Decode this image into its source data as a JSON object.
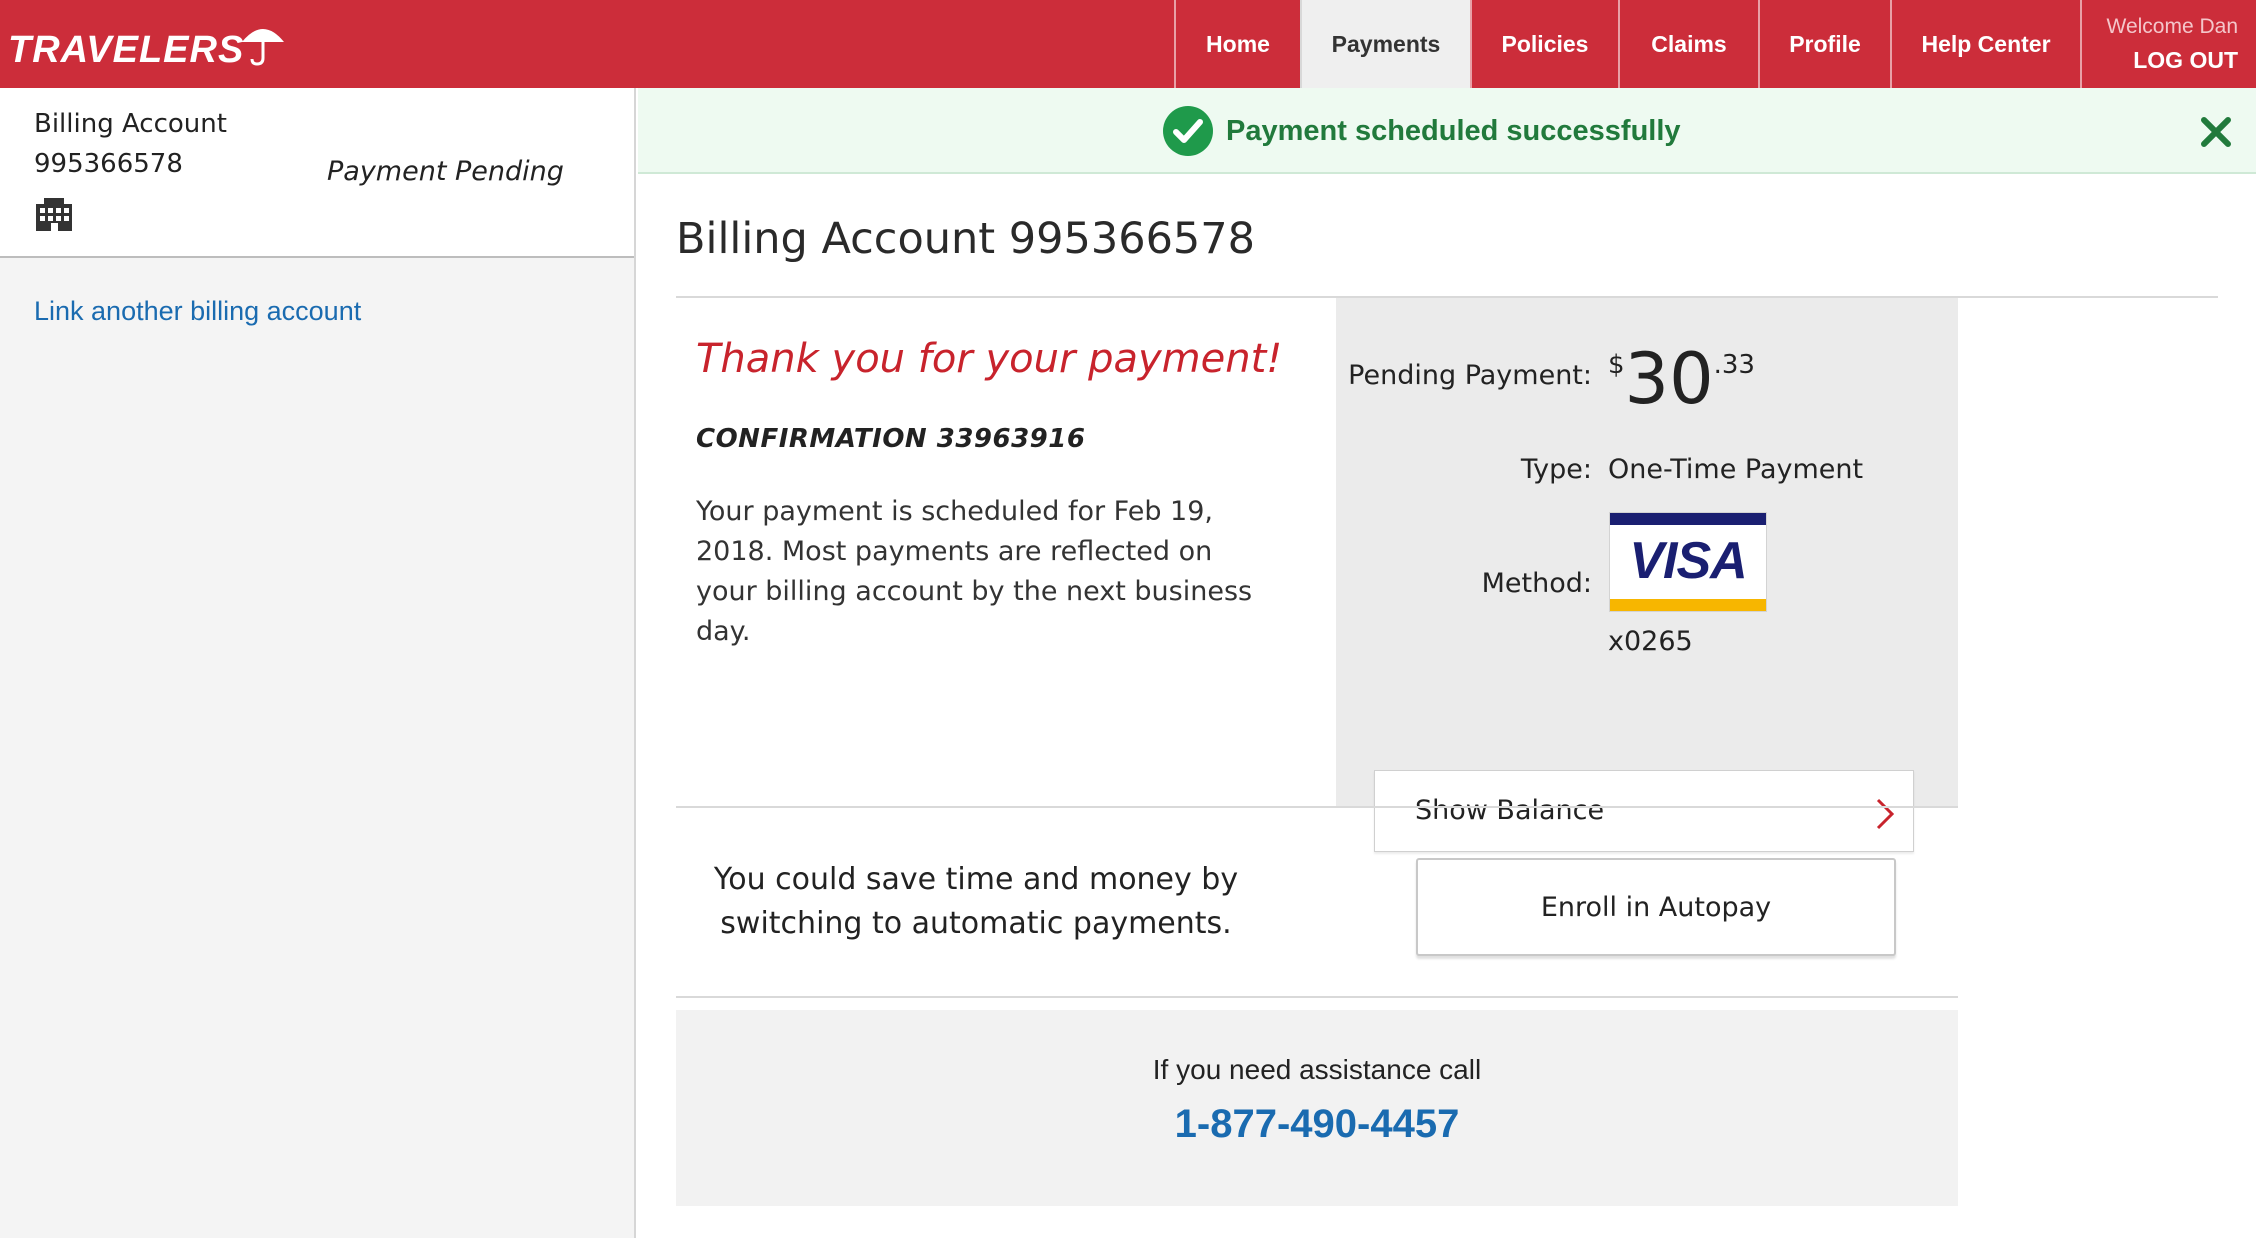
{
  "header": {
    "logo_text": "TRAVELERS",
    "nav": [
      {
        "label": "Home"
      },
      {
        "label": "Payments"
      },
      {
        "label": "Policies"
      },
      {
        "label": "Claims"
      },
      {
        "label": "Profile"
      },
      {
        "label": "Help Center"
      }
    ],
    "welcome": "Welcome Dan",
    "logout": "LOG OUT",
    "brand_color": "#cc2d3a",
    "active_tab": "Payments"
  },
  "sidebar": {
    "account_label": "Billing Account",
    "account_number": "995366578",
    "account_status": "Payment Pending",
    "account_icon": "building-icon",
    "link_text": "Link another billing account"
  },
  "banner": {
    "message": "Payment scheduled successfully",
    "icon": "check-circle-icon",
    "close_icon": "close-icon",
    "color": "#217a3c"
  },
  "main": {
    "title": "Billing Account 995366578",
    "thanks": "Thank you for your payment!",
    "confirmation": "CONFIRMATION 33963916",
    "schedule_text": "Your payment is scheduled for Feb 19, 2018. Most payments are reflected on your billing account by the next business day.",
    "details": {
      "pending_label": "Pending Payment:",
      "amount_symbol": "$",
      "amount_dollars": "30",
      "amount_cents": ".33",
      "type_label": "Type:",
      "type_value": "One-Time Payment",
      "method_label": "Method:",
      "card_brand": "VISA",
      "card_last4": "x0265",
      "show_balance": "Show Balance"
    },
    "autopay": {
      "text": "You could save time and money by switching to automatic payments.",
      "button": "Enroll in Autopay"
    },
    "assistance": {
      "text": "If you need assistance call",
      "phone": "1-877-490-4457"
    }
  }
}
